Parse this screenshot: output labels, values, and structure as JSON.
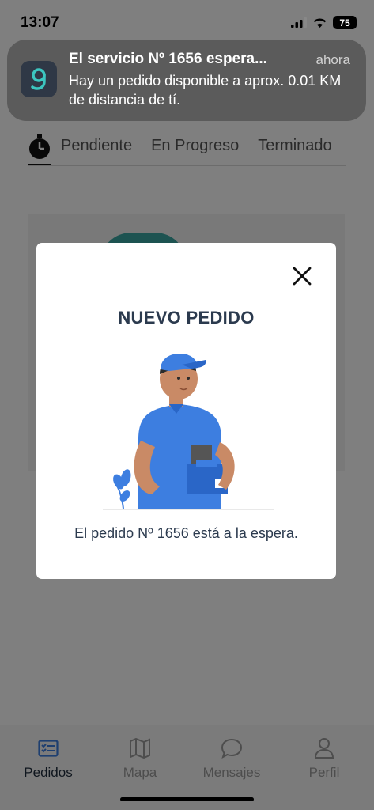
{
  "status_bar": {
    "time": "13:07",
    "battery": "75"
  },
  "tabs": [
    "Pendiente",
    "En Progreso",
    "Terminado"
  ],
  "notification": {
    "title": "El servicio Nº 1656 espera...",
    "time": "ahora",
    "body": "Hay un pedido disponible a aprox. 0.01 KM de distancia de tí."
  },
  "modal": {
    "title": "NUEVO PEDIDO",
    "message": "El pedido Nº 1656 está a la espera."
  },
  "bottom_nav": {
    "items": [
      {
        "label": "Pedidos",
        "icon": "orders-icon",
        "active": true
      },
      {
        "label": "Mapa",
        "icon": "map-icon",
        "active": false
      },
      {
        "label": "Mensajes",
        "icon": "chat-icon",
        "active": false
      },
      {
        "label": "Perfil",
        "icon": "user-icon",
        "active": false
      }
    ]
  },
  "colors": {
    "accent": "#3d7ee0",
    "brand_teal": "#3aa7a3",
    "text_dark": "#2b3a4e"
  }
}
